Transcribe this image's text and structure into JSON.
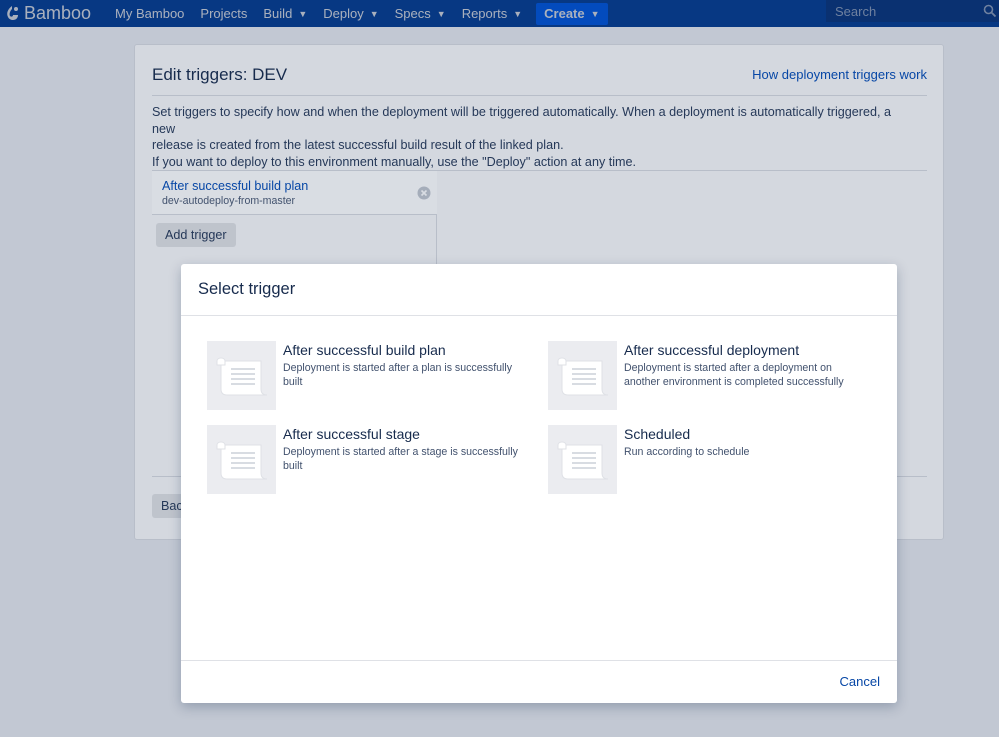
{
  "nav": {
    "brand": "Bamboo",
    "items": [
      {
        "label": "My Bamboo",
        "dropdown": false
      },
      {
        "label": "Projects",
        "dropdown": false
      },
      {
        "label": "Build",
        "dropdown": true
      },
      {
        "label": "Deploy",
        "dropdown": true
      },
      {
        "label": "Specs",
        "dropdown": true
      },
      {
        "label": "Reports",
        "dropdown": true
      }
    ],
    "create_label": "Create",
    "search_placeholder": "Search"
  },
  "page": {
    "title": "Edit triggers: DEV",
    "help_link": "How deployment triggers work",
    "description_lines": [
      "Set triggers to specify how and when the deployment will be triggered automatically. When a deployment is automatically triggered, a new",
      "release is created from the latest successful build result of the linked plan.",
      "If you want to deploy to this environment manually, use the \"Deploy\" action at any time."
    ],
    "existing_trigger": {
      "name": "After successful build plan",
      "detail": "dev-autodeploy-from-master"
    },
    "add_trigger_label": "Add trigger",
    "back_label": "Back"
  },
  "dialog": {
    "title": "Select trigger",
    "options": [
      {
        "title": "After successful build plan",
        "description": "Deployment is started after a plan is successfully built"
      },
      {
        "title": "After successful deployment",
        "description": "Deployment is started after a deployment on another environment is completed successfully"
      },
      {
        "title": "After successful stage",
        "description": "Deployment is started after a stage is successfully built"
      },
      {
        "title": "Scheduled",
        "description": "Run according to schedule"
      }
    ],
    "cancel_label": "Cancel"
  },
  "colors": {
    "nav_bg": "#0747a6",
    "create_bg": "#0065ff",
    "link": "#0747a6",
    "overlay": "#c2c8d3"
  }
}
